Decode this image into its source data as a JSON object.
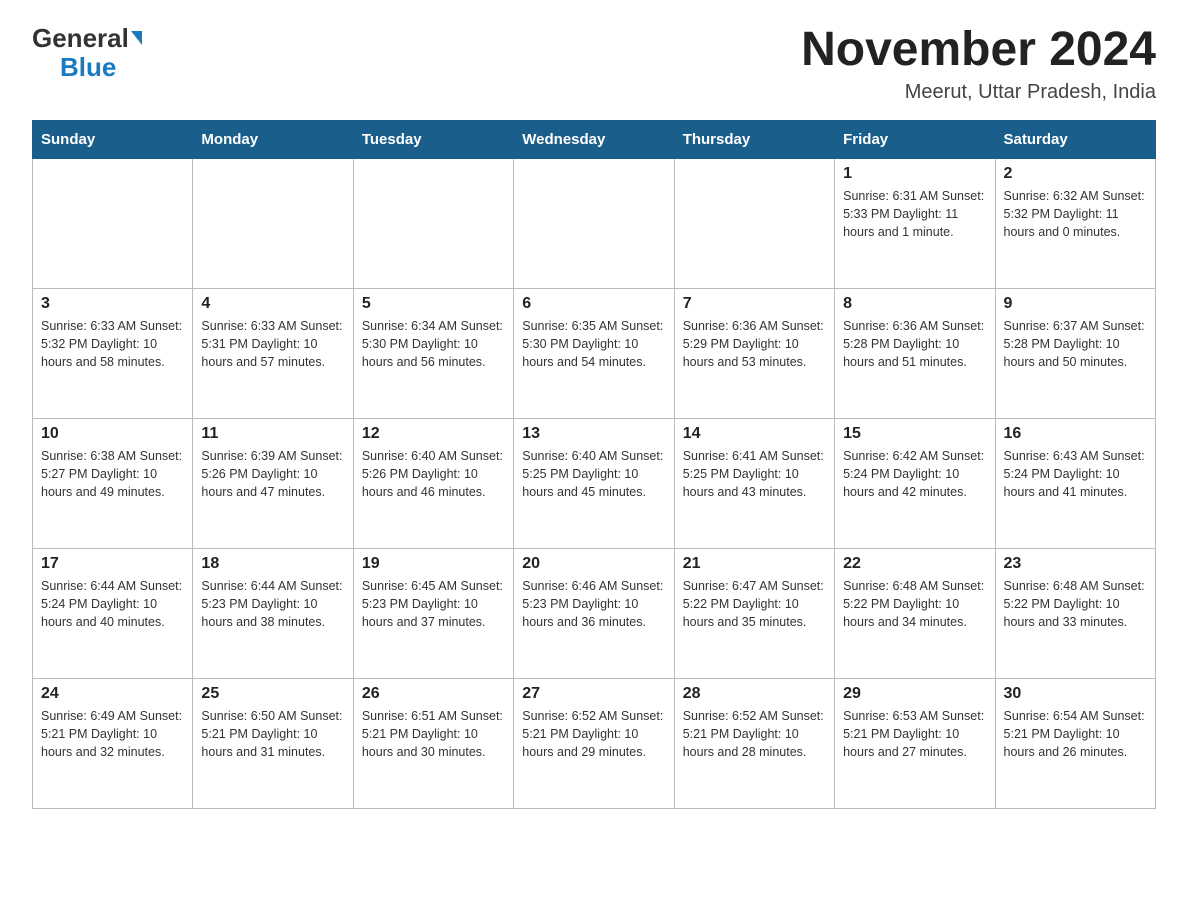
{
  "logo": {
    "general": "General",
    "blue": "Blue",
    "triangle": "▲"
  },
  "title": "November 2024",
  "subtitle": "Meerut, Uttar Pradesh, India",
  "days_of_week": [
    "Sunday",
    "Monday",
    "Tuesday",
    "Wednesday",
    "Thursday",
    "Friday",
    "Saturday"
  ],
  "weeks": [
    [
      {
        "day": "",
        "info": ""
      },
      {
        "day": "",
        "info": ""
      },
      {
        "day": "",
        "info": ""
      },
      {
        "day": "",
        "info": ""
      },
      {
        "day": "",
        "info": ""
      },
      {
        "day": "1",
        "info": "Sunrise: 6:31 AM\nSunset: 5:33 PM\nDaylight: 11 hours and 1 minute."
      },
      {
        "day": "2",
        "info": "Sunrise: 6:32 AM\nSunset: 5:32 PM\nDaylight: 11 hours and 0 minutes."
      }
    ],
    [
      {
        "day": "3",
        "info": "Sunrise: 6:33 AM\nSunset: 5:32 PM\nDaylight: 10 hours and 58 minutes."
      },
      {
        "day": "4",
        "info": "Sunrise: 6:33 AM\nSunset: 5:31 PM\nDaylight: 10 hours and 57 minutes."
      },
      {
        "day": "5",
        "info": "Sunrise: 6:34 AM\nSunset: 5:30 PM\nDaylight: 10 hours and 56 minutes."
      },
      {
        "day": "6",
        "info": "Sunrise: 6:35 AM\nSunset: 5:30 PM\nDaylight: 10 hours and 54 minutes."
      },
      {
        "day": "7",
        "info": "Sunrise: 6:36 AM\nSunset: 5:29 PM\nDaylight: 10 hours and 53 minutes."
      },
      {
        "day": "8",
        "info": "Sunrise: 6:36 AM\nSunset: 5:28 PM\nDaylight: 10 hours and 51 minutes."
      },
      {
        "day": "9",
        "info": "Sunrise: 6:37 AM\nSunset: 5:28 PM\nDaylight: 10 hours and 50 minutes."
      }
    ],
    [
      {
        "day": "10",
        "info": "Sunrise: 6:38 AM\nSunset: 5:27 PM\nDaylight: 10 hours and 49 minutes."
      },
      {
        "day": "11",
        "info": "Sunrise: 6:39 AM\nSunset: 5:26 PM\nDaylight: 10 hours and 47 minutes."
      },
      {
        "day": "12",
        "info": "Sunrise: 6:40 AM\nSunset: 5:26 PM\nDaylight: 10 hours and 46 minutes."
      },
      {
        "day": "13",
        "info": "Sunrise: 6:40 AM\nSunset: 5:25 PM\nDaylight: 10 hours and 45 minutes."
      },
      {
        "day": "14",
        "info": "Sunrise: 6:41 AM\nSunset: 5:25 PM\nDaylight: 10 hours and 43 minutes."
      },
      {
        "day": "15",
        "info": "Sunrise: 6:42 AM\nSunset: 5:24 PM\nDaylight: 10 hours and 42 minutes."
      },
      {
        "day": "16",
        "info": "Sunrise: 6:43 AM\nSunset: 5:24 PM\nDaylight: 10 hours and 41 minutes."
      }
    ],
    [
      {
        "day": "17",
        "info": "Sunrise: 6:44 AM\nSunset: 5:24 PM\nDaylight: 10 hours and 40 minutes."
      },
      {
        "day": "18",
        "info": "Sunrise: 6:44 AM\nSunset: 5:23 PM\nDaylight: 10 hours and 38 minutes."
      },
      {
        "day": "19",
        "info": "Sunrise: 6:45 AM\nSunset: 5:23 PM\nDaylight: 10 hours and 37 minutes."
      },
      {
        "day": "20",
        "info": "Sunrise: 6:46 AM\nSunset: 5:23 PM\nDaylight: 10 hours and 36 minutes."
      },
      {
        "day": "21",
        "info": "Sunrise: 6:47 AM\nSunset: 5:22 PM\nDaylight: 10 hours and 35 minutes."
      },
      {
        "day": "22",
        "info": "Sunrise: 6:48 AM\nSunset: 5:22 PM\nDaylight: 10 hours and 34 minutes."
      },
      {
        "day": "23",
        "info": "Sunrise: 6:48 AM\nSunset: 5:22 PM\nDaylight: 10 hours and 33 minutes."
      }
    ],
    [
      {
        "day": "24",
        "info": "Sunrise: 6:49 AM\nSunset: 5:21 PM\nDaylight: 10 hours and 32 minutes."
      },
      {
        "day": "25",
        "info": "Sunrise: 6:50 AM\nSunset: 5:21 PM\nDaylight: 10 hours and 31 minutes."
      },
      {
        "day": "26",
        "info": "Sunrise: 6:51 AM\nSunset: 5:21 PM\nDaylight: 10 hours and 30 minutes."
      },
      {
        "day": "27",
        "info": "Sunrise: 6:52 AM\nSunset: 5:21 PM\nDaylight: 10 hours and 29 minutes."
      },
      {
        "day": "28",
        "info": "Sunrise: 6:52 AM\nSunset: 5:21 PM\nDaylight: 10 hours and 28 minutes."
      },
      {
        "day": "29",
        "info": "Sunrise: 6:53 AM\nSunset: 5:21 PM\nDaylight: 10 hours and 27 minutes."
      },
      {
        "day": "30",
        "info": "Sunrise: 6:54 AM\nSunset: 5:21 PM\nDaylight: 10 hours and 26 minutes."
      }
    ]
  ]
}
